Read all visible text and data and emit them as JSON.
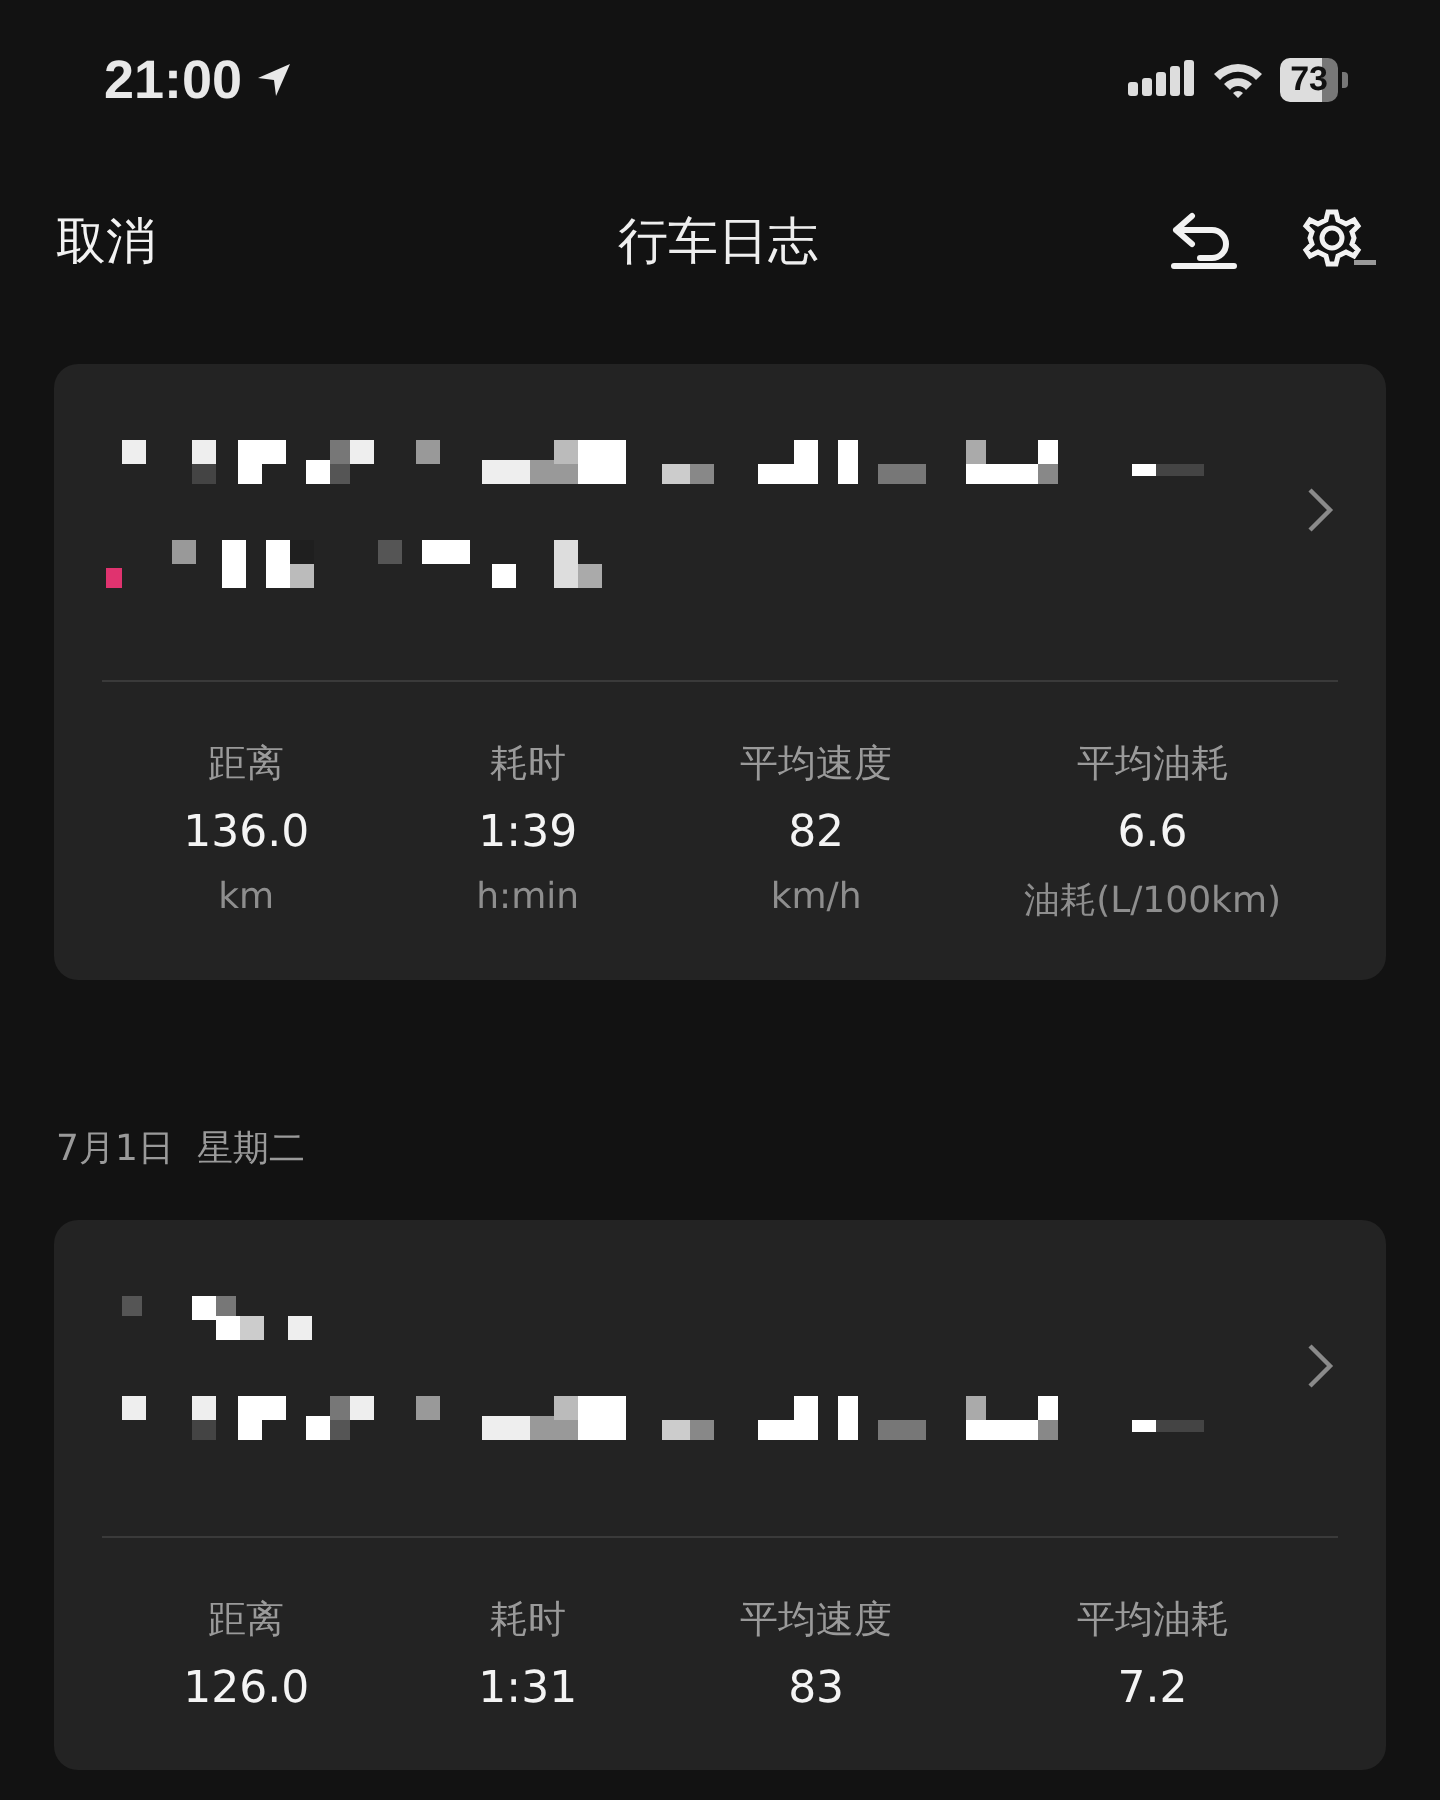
{
  "status_bar": {
    "time": "21:00",
    "battery": "73"
  },
  "nav": {
    "cancel": "取消",
    "title": "行车日志"
  },
  "trips": [
    {
      "stats": [
        {
          "label": "距离",
          "value": "136.0",
          "unit": "km"
        },
        {
          "label": "耗时",
          "value": "1:39",
          "unit": "h:min"
        },
        {
          "label": "平均速度",
          "value": "82",
          "unit": "km/h"
        },
        {
          "label": "平均油耗",
          "value": "6.6",
          "unit": "油耗(L/100km)"
        }
      ]
    },
    {
      "date": "7月1日  星期二",
      "stats": [
        {
          "label": "距离",
          "value": "126.0"
        },
        {
          "label": "耗时",
          "value": "1:31"
        },
        {
          "label": "平均速度",
          "value": "83"
        },
        {
          "label": "平均油耗",
          "value": "7.2"
        }
      ]
    }
  ]
}
